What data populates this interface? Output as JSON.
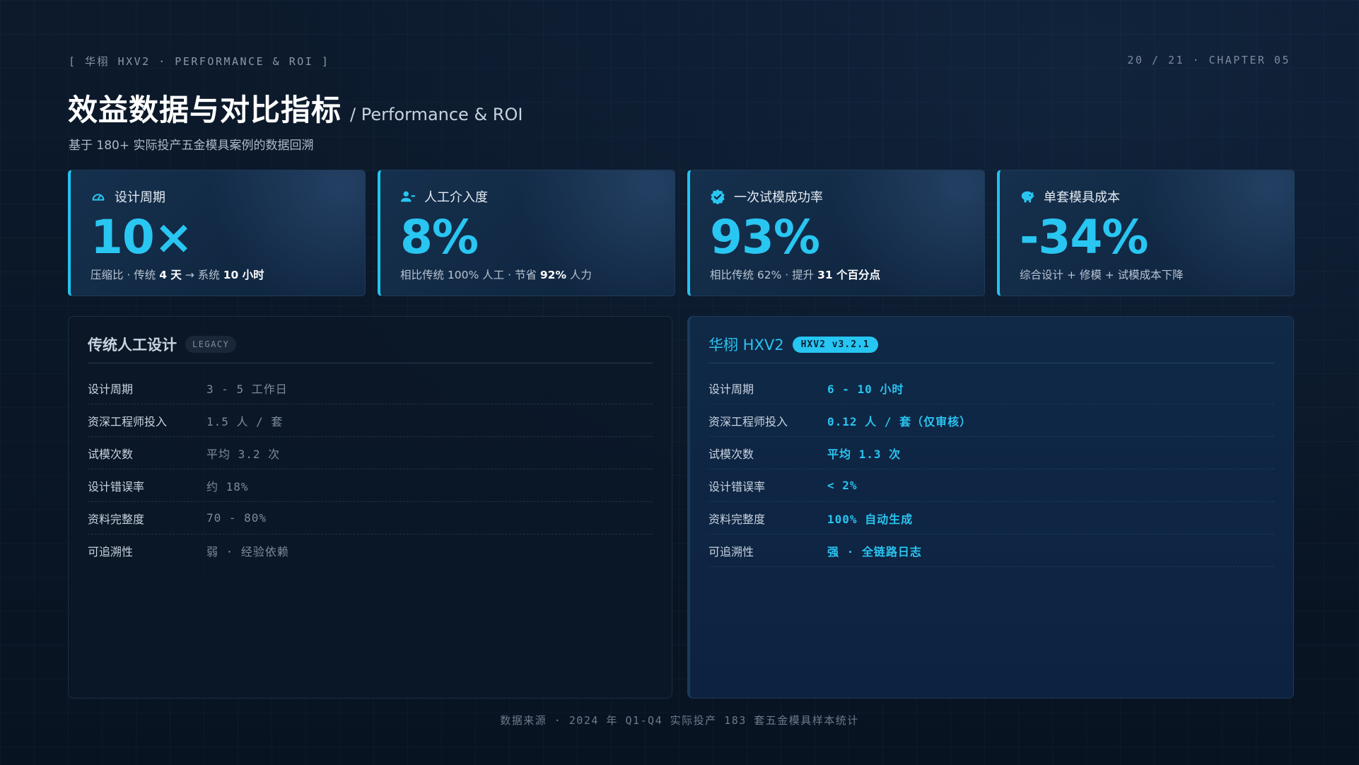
{
  "header": {
    "breadcrumb": "[ 华栩 HXV2 · PERFORMANCE & ROI ]",
    "pager": "20 / 21 · CHAPTER 05",
    "title": "效益数据与对比指标",
    "title_suffix": "/ Performance & ROI",
    "subtitle": "基于 180+ 实际投产五金模具案例的数据回溯"
  },
  "colors": {
    "accent": "#22c3ef",
    "background": "#0a1626"
  },
  "kpis": [
    {
      "icon": "gauge-icon",
      "label": "设计周期",
      "value": "10×",
      "note_prefix": "压缩比 · 传统 ",
      "note_b1": "4 天",
      "note_mid": " → 系统 ",
      "note_b2": "10 小时",
      "note_suffix": ""
    },
    {
      "icon": "user-minus-icon",
      "label": "人工介入度",
      "value": "8%",
      "note_prefix": "相比传统 100% 人工 · 节省 ",
      "note_b1": "92%",
      "note_mid": " 人力",
      "note_b2": "",
      "note_suffix": ""
    },
    {
      "icon": "badge-check-icon",
      "label": "一次试模成功率",
      "value": "93%",
      "note_prefix": "相比传统 62% · 提升 ",
      "note_b1": "31 个百分点",
      "note_mid": "",
      "note_b2": "",
      "note_suffix": ""
    },
    {
      "icon": "piggy-bank-icon",
      "label": "单套模具成本",
      "value": "-34%",
      "note_prefix": "综合设计 + 修模 + 试模成本下降",
      "note_b1": "",
      "note_mid": "",
      "note_b2": "",
      "note_suffix": ""
    }
  ],
  "legacy": {
    "title": "传统人工设计",
    "badge": "LEGACY",
    "rows": [
      {
        "label": "设计周期",
        "value": "3 - 5 工作日"
      },
      {
        "label": "资深工程师投入",
        "value": "1.5 人 / 套"
      },
      {
        "label": "试模次数",
        "value": "平均 3.2 次"
      },
      {
        "label": "设计错误率",
        "value": "约 18%"
      },
      {
        "label": "资料完整度",
        "value": "70 - 80%"
      },
      {
        "label": "可追溯性",
        "value": "弱 · 经验依赖"
      }
    ]
  },
  "hxv2": {
    "title": "华栩 HXV2",
    "badge": "HXV2 v3.2.1",
    "rows": [
      {
        "label": "设计周期",
        "value": "6 - 10 小时"
      },
      {
        "label": "资深工程师投入",
        "value": "0.12 人 / 套（仅审核）"
      },
      {
        "label": "试模次数",
        "value": "平均 1.3 次"
      },
      {
        "label": "设计错误率",
        "value": "< 2%"
      },
      {
        "label": "资料完整度",
        "value": "100% 自动生成"
      },
      {
        "label": "可追溯性",
        "value": "强 · 全链路日志"
      }
    ]
  },
  "footer": {
    "source": "数据来源 · 2024 年 Q1-Q4 实际投产 183 套五金模具样本统计"
  }
}
